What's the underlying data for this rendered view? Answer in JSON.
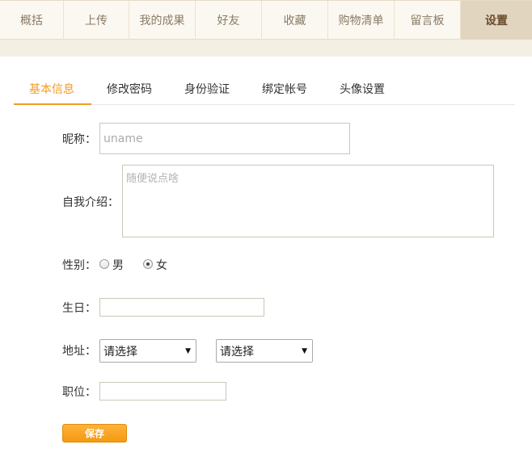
{
  "nav": {
    "tabs": [
      {
        "label": "概括"
      },
      {
        "label": "上传"
      },
      {
        "label": "我的成果"
      },
      {
        "label": "好友"
      },
      {
        "label": "收藏"
      },
      {
        "label": "购物清单"
      },
      {
        "label": "留言板"
      },
      {
        "label": "设置",
        "active": true
      }
    ]
  },
  "subtabs": [
    {
      "label": "基本信息",
      "active": true
    },
    {
      "label": "修改密码"
    },
    {
      "label": "身份验证"
    },
    {
      "label": "绑定帐号"
    },
    {
      "label": "头像设置"
    }
  ],
  "form": {
    "nickname_label": "昵称：",
    "nickname_placeholder": "uname",
    "intro_label": "自我介绍：",
    "intro_placeholder": "随便说点啥",
    "gender_label": "性别：",
    "gender_male": "男",
    "gender_female": "女",
    "gender_selected": "女",
    "birthday_label": "生日：",
    "birthday_value": "",
    "address_label": "地址：",
    "address_select1": "请选择",
    "address_select2": "请选择",
    "position_label": "职位：",
    "position_value": "",
    "save_label": "保存"
  },
  "colors": {
    "accent": "#f39a22",
    "nav_active_bg": "#e1d5bf",
    "nav_bg": "#fbf8f1"
  }
}
